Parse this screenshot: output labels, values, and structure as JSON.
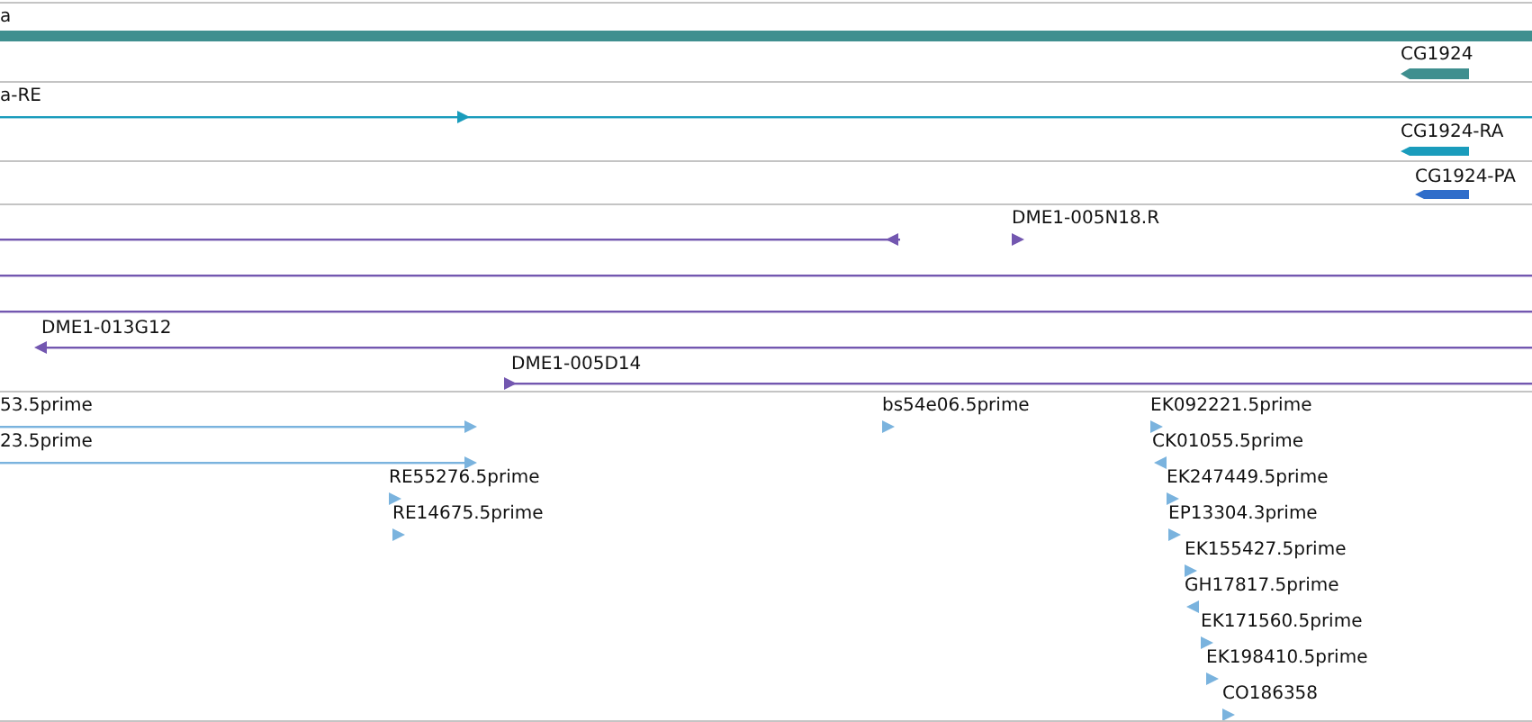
{
  "tracks": [
    {
      "color": "#3f8f8f",
      "features": [
        {
          "label": "a",
          "kind": "bar"
        },
        {
          "label": "CG1924",
          "kind": "bar",
          "reverse": true
        }
      ]
    },
    {
      "color": "#1a9cbc",
      "features": [
        {
          "label": "a-RE",
          "kind": "line",
          "reverse": false
        },
        {
          "label": "CG1924-RA",
          "kind": "bar",
          "reverse": true
        }
      ]
    },
    {
      "color": "#2f6dca",
      "features": [
        {
          "label": "CG1924-PA",
          "kind": "bar",
          "reverse": true
        }
      ]
    },
    {
      "color": "#7357b0",
      "features": [
        {
          "kind": "line",
          "reverse": true
        },
        {
          "label": "DME1-005N18.R",
          "kind": "marker",
          "reverse": false
        },
        {
          "kind": "line"
        },
        {
          "kind": "line"
        },
        {
          "label": "DME1-013G12",
          "kind": "line",
          "reverse": true
        },
        {
          "label": "DME1-005D14",
          "kind": "line",
          "reverse": false
        }
      ]
    },
    {
      "color": "#7ab3de",
      "features": [
        {
          "label": "53.5prime",
          "kind": "line",
          "reverse": false
        },
        {
          "label": "23.5prime",
          "kind": "line",
          "reverse": false
        },
        {
          "label": "RE55276.5prime",
          "kind": "marker",
          "reverse": false
        },
        {
          "label": "RE14675.5prime",
          "kind": "marker",
          "reverse": false
        },
        {
          "label": "bs54e06.5prime",
          "kind": "marker",
          "reverse": false
        },
        {
          "label": "EK092221.5prime",
          "kind": "marker",
          "reverse": false
        },
        {
          "label": "CK01055.5prime",
          "kind": "marker",
          "reverse": true
        },
        {
          "label": "EK247449.5prime",
          "kind": "marker",
          "reverse": false
        },
        {
          "label": "EP13304.3prime",
          "kind": "marker",
          "reverse": false
        },
        {
          "label": "EK155427.5prime",
          "kind": "marker",
          "reverse": false
        },
        {
          "label": "GH17817.5prime",
          "kind": "marker",
          "reverse": true
        },
        {
          "label": "EK171560.5prime",
          "kind": "marker",
          "reverse": false
        },
        {
          "label": "EK198410.5prime",
          "kind": "marker",
          "reverse": false
        },
        {
          "label": "CO186358",
          "kind": "marker",
          "reverse": false
        }
      ]
    }
  ]
}
